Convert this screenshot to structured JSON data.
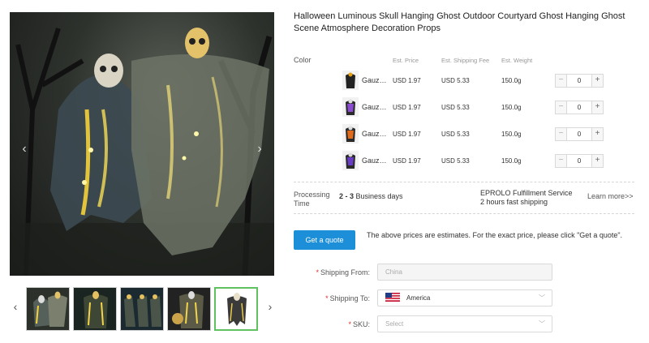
{
  "gallery": {
    "prev_label": "‹",
    "next_label": "›",
    "thumb_prev_label": "‹",
    "thumb_next_label": "›",
    "thumbnail_count": 5,
    "active_thumbnail": 5
  },
  "product": {
    "title": "Halloween Luminous Skull Hanging Ghost Outdoor Courtyard Ghost Hanging Ghost Scene Atmosphere Decoration Props"
  },
  "variants": {
    "color_label": "Color",
    "headers": {
      "price": "Est. Price",
      "shipping": "Est. Shipping Fee",
      "weight": "Est. Weight"
    },
    "rows": [
      {
        "name": "Gauz…",
        "price": "USD 1.97",
        "shipping": "USD 5.33",
        "weight": "150.0g",
        "qty": "0",
        "accent": "#e5a01a"
      },
      {
        "name": "Gauz…",
        "price": "USD 1.97",
        "shipping": "USD 5.33",
        "weight": "150.0g",
        "qty": "0",
        "accent": "#8a4bd1"
      },
      {
        "name": "Gauz…",
        "price": "USD 1.97",
        "shipping": "USD 5.33",
        "weight": "150.0g",
        "qty": "0",
        "accent": "#e06a1a"
      },
      {
        "name": "Gauz…",
        "price": "USD 1.97",
        "shipping": "USD 5.33",
        "weight": "150.0g",
        "qty": "0",
        "accent": "#6a3cc4"
      }
    ],
    "minus_label": "−",
    "plus_label": "+"
  },
  "processing": {
    "label": "Processing Time",
    "days_bold": "2 - 3",
    "days_rest": " Business days",
    "service_line1": "EPROLO Fulfillment Service",
    "service_line2": "2 hours fast shipping",
    "learn_more": "Learn more>>"
  },
  "quote": {
    "button_label": "Get a quote",
    "note": "The above prices are estimates. For the exact price, please click \"Get a quote\"."
  },
  "form": {
    "required_mark": "*",
    "shipping_from_label": "Shipping From:",
    "shipping_from_value": "China",
    "shipping_to_label": "Shipping To:",
    "shipping_to_value": "America",
    "sku_label": "SKU:",
    "sku_placeholder": "Select",
    "chevron": "﹀"
  },
  "colors": {
    "accent_blue": "#1d8fd8",
    "required_red": "#e0322c",
    "active_thumb_border": "#5fc15f"
  }
}
